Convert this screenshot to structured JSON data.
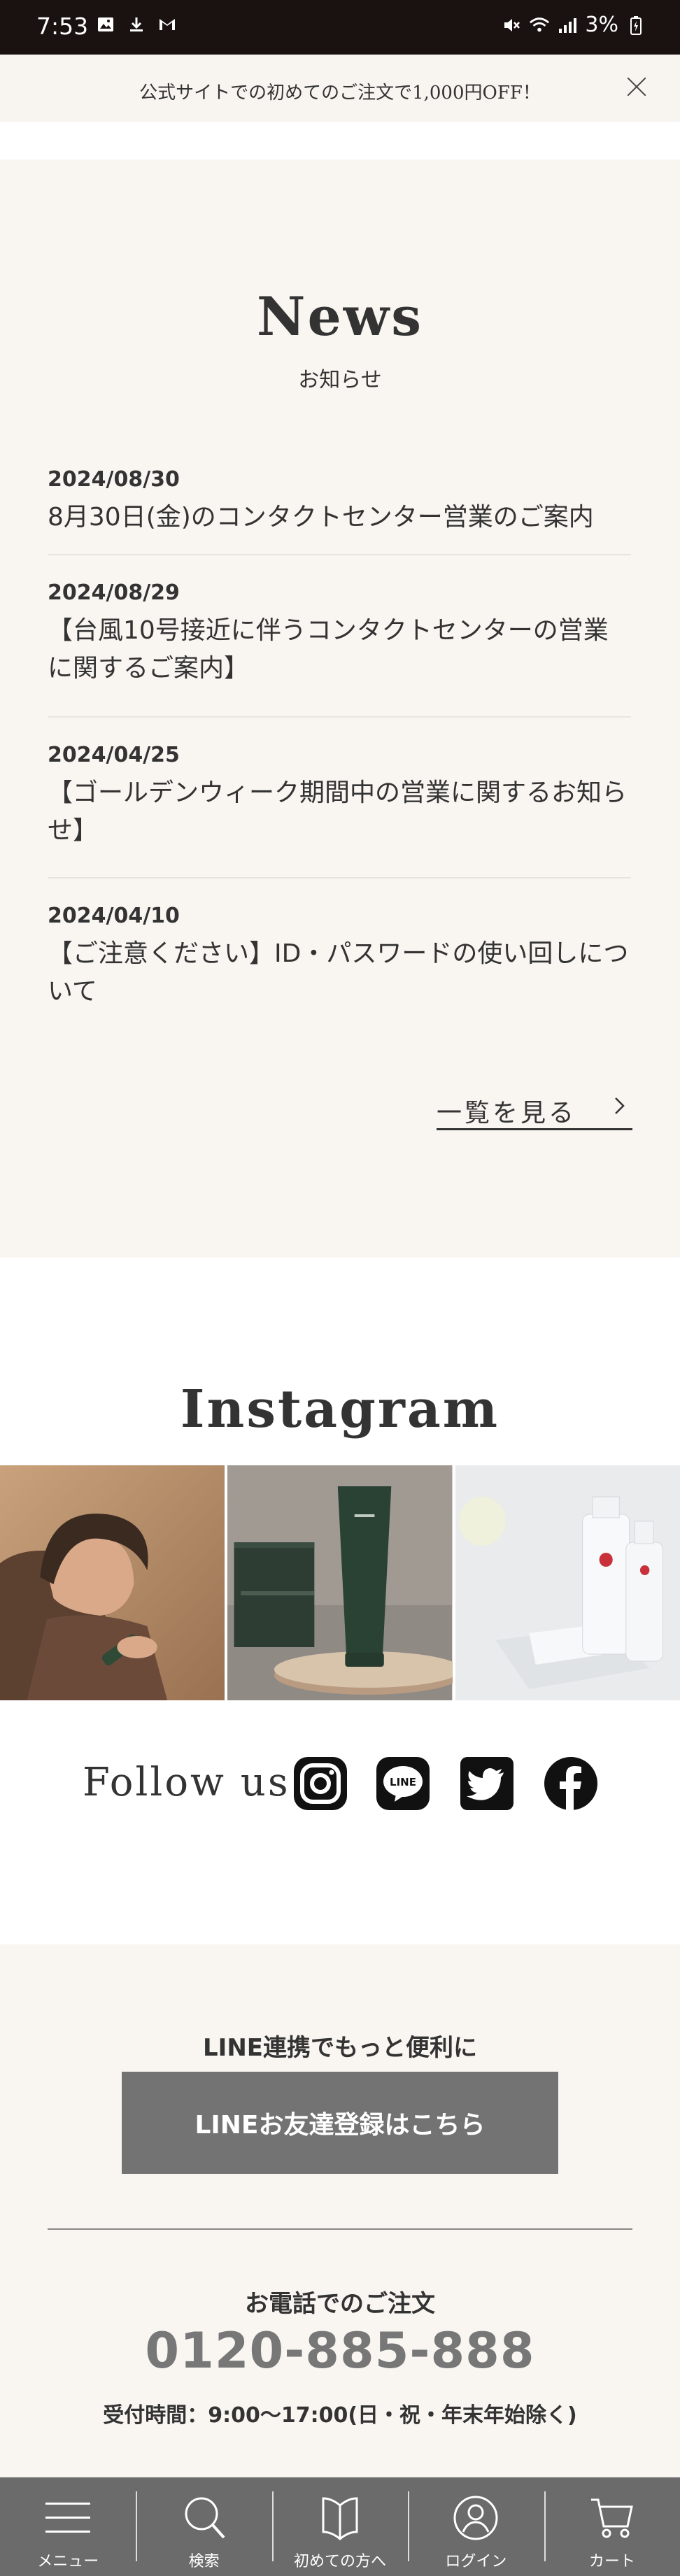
{
  "status_bar": {
    "time": "7:53",
    "battery": "3%"
  },
  "announcement": {
    "text": "公式サイトでの初めてのご注文で1,000円OFF！"
  },
  "news": {
    "title": "News",
    "subtitle": "お知らせ",
    "items": [
      {
        "date": "2024/08/30",
        "title": "8月30日(金)のコンタクトセンター営業のご案内"
      },
      {
        "date": "2024/08/29",
        "title": "【台風10号接近に伴うコンタクトセンターの営業に関するご案内】"
      },
      {
        "date": "2024/04/25",
        "title": "【ゴールデンウィーク期間中の営業に関するお知らせ】"
      },
      {
        "date": "2024/04/10",
        "title": "【ご注意ください】ID・パスワードの使い回しについて"
      }
    ],
    "more_label": "一覧を見る"
  },
  "instagram": {
    "title": "Instagram",
    "follow_label": "Follow us",
    "line_logo_text": "LINE"
  },
  "info": {
    "line_heading": "LINE連携でもっと便利に",
    "line_button": "LINEお友達登録はこちら",
    "tel_heading": "お電話でのご注文",
    "tel_number": "0120-885-888",
    "tel_hours": "受付時間：9:00～17:00(日・祝・年末年始除く)"
  },
  "bottom_nav": {
    "items": [
      {
        "label": "メニュー",
        "icon": "menu-icon"
      },
      {
        "label": "検索",
        "icon": "search-icon"
      },
      {
        "label": "初めての方へ",
        "icon": "book-icon"
      },
      {
        "label": "ログイン",
        "icon": "user-icon"
      },
      {
        "label": "カート",
        "icon": "cart-icon"
      }
    ]
  },
  "colors": {
    "status_bar": "#1a1210",
    "section_bg": "#f9f6f2",
    "line_button": "#737373",
    "nav_bg": "#6b6b6b",
    "tel_number": "#777777"
  }
}
